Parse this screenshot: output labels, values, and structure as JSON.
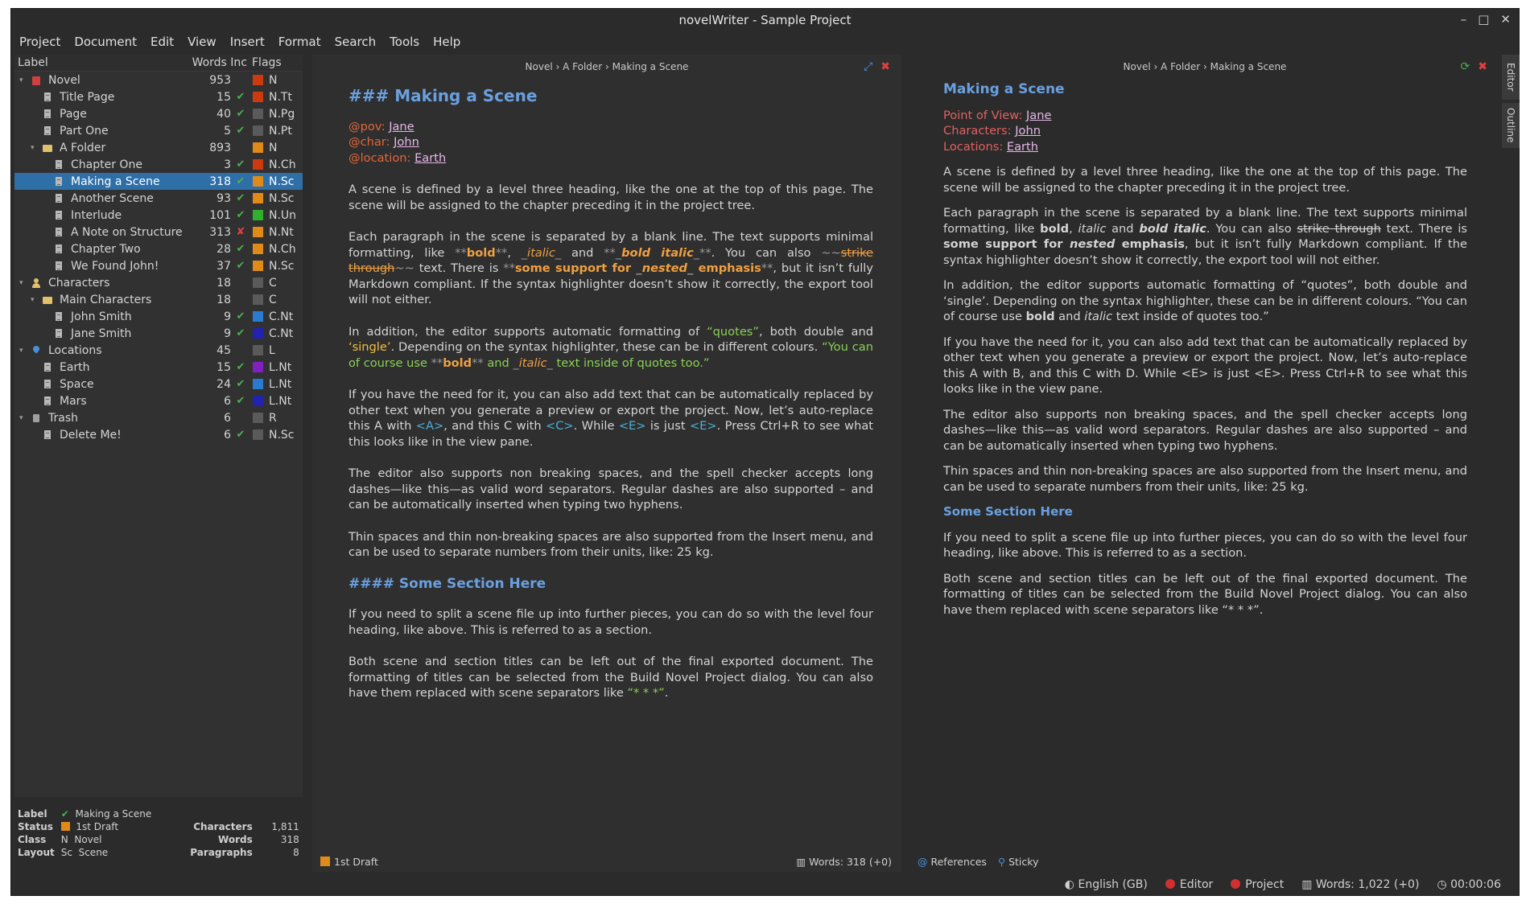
{
  "window": {
    "title": "novelWriter - Sample Project",
    "controls": [
      "–",
      "□",
      "✕"
    ]
  },
  "menu": [
    "Project",
    "Document",
    "Edit",
    "View",
    "Insert",
    "Format",
    "Search",
    "Tools",
    "Help"
  ],
  "tree": {
    "headers": {
      "label": "Label",
      "words": "Words Inc",
      "flags": "Flags"
    },
    "rows": [
      {
        "label": "Novel",
        "icon": "novel",
        "indent": 0,
        "arrow": "▾",
        "words": "953",
        "check": "",
        "color": "#cc3a10",
        "flag": "N"
      },
      {
        "label": "Title Page",
        "icon": "doc",
        "indent": 1,
        "arrow": "",
        "words": "15",
        "check": "✔",
        "color": "#cc3a10",
        "flag": "N.Tt"
      },
      {
        "label": "Page",
        "icon": "doc",
        "indent": 1,
        "arrow": "",
        "words": "40",
        "check": "✔",
        "color": "#5a5a5a",
        "flag": "N.Pg"
      },
      {
        "label": "Part One",
        "icon": "doc",
        "indent": 1,
        "arrow": "",
        "words": "5",
        "check": "✔",
        "color": "#5a5a5a",
        "flag": "N.Pt"
      },
      {
        "label": "A Folder",
        "icon": "folder",
        "indent": 1,
        "arrow": "▾",
        "words": "893",
        "check": "",
        "color": "#e08a1a",
        "flag": "N"
      },
      {
        "label": "Chapter One",
        "icon": "doc",
        "indent": 2,
        "arrow": "",
        "words": "3",
        "check": "✔",
        "color": "#cc3a10",
        "flag": "N.Ch"
      },
      {
        "label": "Making a Scene",
        "icon": "doc",
        "indent": 2,
        "arrow": "",
        "words": "318",
        "check": "✔",
        "color": "#e08a1a",
        "flag": "N.Sc",
        "selected": true
      },
      {
        "label": "Another Scene",
        "icon": "doc",
        "indent": 2,
        "arrow": "",
        "words": "93",
        "check": "✔",
        "color": "#e08a1a",
        "flag": "N.Sc"
      },
      {
        "label": "Interlude",
        "icon": "doc",
        "indent": 2,
        "arrow": "",
        "words": "101",
        "check": "✔",
        "color": "#2fb02f",
        "flag": "N.Un"
      },
      {
        "label": "A Note on Structure",
        "icon": "doc",
        "indent": 2,
        "arrow": "",
        "words": "313",
        "check": "✘",
        "color": "#e08a1a",
        "flag": "N.Nt"
      },
      {
        "label": "Chapter Two",
        "icon": "doc",
        "indent": 2,
        "arrow": "",
        "words": "28",
        "check": "✔",
        "color": "#e08a1a",
        "flag": "N.Ch"
      },
      {
        "label": "We Found John!",
        "icon": "doc",
        "indent": 2,
        "arrow": "",
        "words": "37",
        "check": "✔",
        "color": "#e08a1a",
        "flag": "N.Sc"
      },
      {
        "label": "Characters",
        "icon": "chars",
        "indent": 0,
        "arrow": "▾",
        "words": "18",
        "check": "",
        "color": "#5a5a5a",
        "flag": "C"
      },
      {
        "label": "Main Characters",
        "icon": "folder",
        "indent": 1,
        "arrow": "▾",
        "words": "18",
        "check": "",
        "color": "#5a5a5a",
        "flag": "C"
      },
      {
        "label": "John Smith",
        "icon": "doc",
        "indent": 2,
        "arrow": "",
        "words": "9",
        "check": "✔",
        "color": "#2a7ad0",
        "flag": "C.Nt"
      },
      {
        "label": "Jane Smith",
        "icon": "doc",
        "indent": 2,
        "arrow": "",
        "words": "9",
        "check": "✔",
        "color": "#2222b0",
        "flag": "C.Nt"
      },
      {
        "label": "Locations",
        "icon": "pin",
        "indent": 0,
        "arrow": "▾",
        "words": "45",
        "check": "",
        "color": "#5a5a5a",
        "flag": "L"
      },
      {
        "label": "Earth",
        "icon": "doc",
        "indent": 1,
        "arrow": "",
        "words": "15",
        "check": "✔",
        "color": "#8020c0",
        "flag": "L.Nt"
      },
      {
        "label": "Space",
        "icon": "doc",
        "indent": 1,
        "arrow": "",
        "words": "24",
        "check": "✔",
        "color": "#2a7ad0",
        "flag": "L.Nt"
      },
      {
        "label": "Mars",
        "icon": "doc",
        "indent": 1,
        "arrow": "",
        "words": "6",
        "check": "✔",
        "color": "#2222b0",
        "flag": "L.Nt"
      },
      {
        "label": "Trash",
        "icon": "trash",
        "indent": 0,
        "arrow": "▾",
        "words": "6",
        "check": "",
        "color": "#5a5a5a",
        "flag": "R"
      },
      {
        "label": "Delete Me!",
        "icon": "doc",
        "indent": 1,
        "arrow": "",
        "words": "6",
        "check": "✔",
        "color": "#5a5a5a",
        "flag": "N.Sc"
      }
    ]
  },
  "details": {
    "label_k": "Label",
    "label_v": "Making a Scene",
    "status_k": "Status",
    "status_v": "1st Draft",
    "class_k": "Class",
    "class_sym": "N",
    "class_v": "Novel",
    "layout_k": "Layout",
    "layout_sym": "Sc",
    "layout_v": "Scene",
    "chars_k": "Characters",
    "chars_v": "1,811",
    "words_k": "Words",
    "words_v": "318",
    "paras_k": "Paragraphs",
    "paras_v": "8"
  },
  "editor": {
    "breadcrumb": "Novel  ›  A Folder  ›  Making a Scene",
    "heading_marker": "###",
    "heading": "Making a Scene",
    "sub_marker": "####",
    "subheading": "Some Section Here",
    "status": "1st Draft",
    "words": "Words: 318 (+0)"
  },
  "viewer": {
    "breadcrumb": "Novel  ›  A Folder  ›  Making a Scene",
    "heading": "Making a Scene",
    "pov_label": "Point of View:",
    "chars_label": "Characters:",
    "loc_label": "Locations:",
    "pov": "Jane",
    "char": "John",
    "loc": "Earth",
    "p1": "A scene is defined by a level three heading, like the one at the top of this page. The scene will be assigned to the chapter preceding it in the project tree.",
    "p4": "If you have the need for it, you can also add text that can be automatically replaced by other text when you generate a preview or export the project. Now, let’s auto-replace this A with B, and this C with D. While <E> is just <E>. Press Ctrl+R to see what this looks like in the view pane.",
    "p5": "The editor also supports non breaking spaces, and the spell checker accepts long dashes—like this—as valid word separators. Regular dashes are also supported – and can be automatically inserted when typing two hyphens.",
    "p6": "Thin spaces and thin non-breaking spaces are also supported from the Insert menu, and can be used to separate numbers from their units, like: 25 kg.",
    "subheading": "Some Section Here",
    "p7": "If you need to split a scene file up into further pieces, you can do so with the level four heading, like above. This is referred to as a section.",
    "p8": "Both scene and section titles can be left out of the final exported document. The formatting of titles can be selected from the Build Novel Project dialog. You can also have them replaced with scene separators like “* * *”.",
    "references": "References",
    "sticky": "Sticky"
  },
  "sidetabs": [
    "Editor",
    "Outline"
  ],
  "statusbar": {
    "language": "English (GB)",
    "editor": "Editor",
    "project": "Project",
    "words": "Words: 1,022 (+0)",
    "time": "00:00:06"
  }
}
